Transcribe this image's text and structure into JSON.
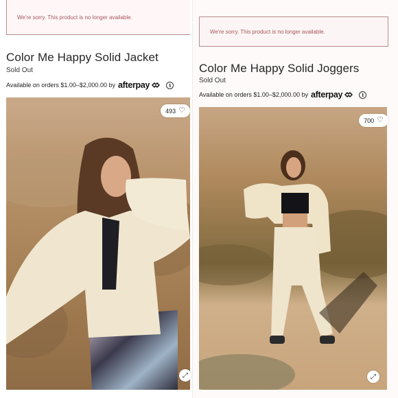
{
  "products": [
    {
      "alert": "We're sorry. This product is no longer available.",
      "title": "Color Me Happy Solid Jacket",
      "status": "Sold Out",
      "afterpay_text": "Available on orders $1.00–$2,000.00 by",
      "afterpay_brand": "afterpay",
      "likes": "493",
      "icons": [
        "heart-icon",
        "expand-icon",
        "info-icon",
        "afterpay-logo-icon"
      ]
    },
    {
      "alert": "We're sorry. This product is no longer available.",
      "title": "Color Me Happy Solid Joggers",
      "status": "Sold Out",
      "afterpay_text": "Available on orders $1.00–$2,000.00 by",
      "afterpay_brand": "afterpay",
      "likes": "700",
      "icons": [
        "heart-icon",
        "expand-icon",
        "info-icon",
        "afterpay-logo-icon"
      ]
    }
  ],
  "colors": {
    "alert_border": "#b98b8e",
    "alert_text": "#a4575c",
    "text": "#262626"
  }
}
